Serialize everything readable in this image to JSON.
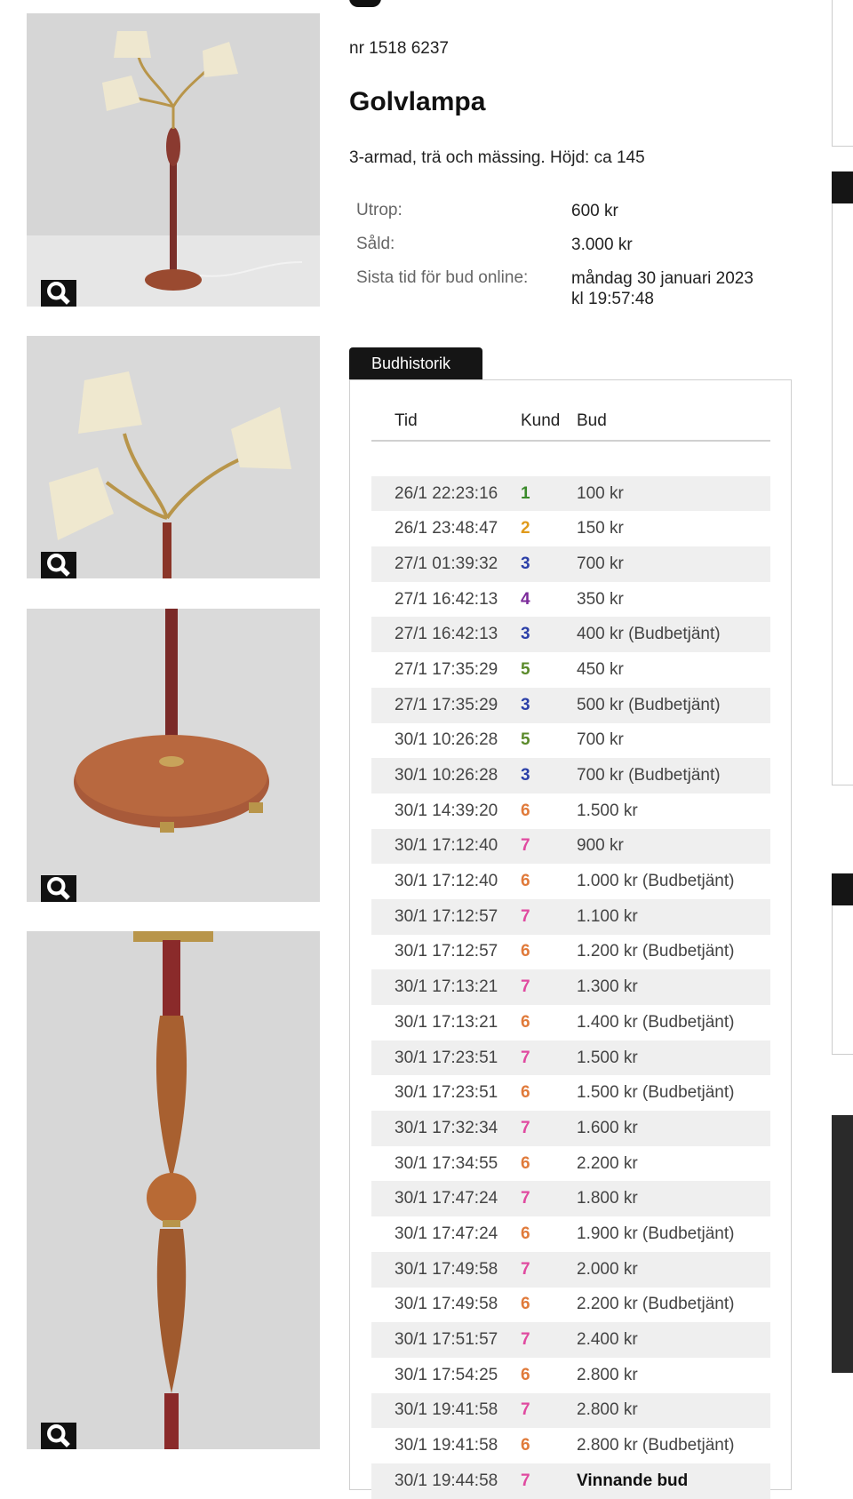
{
  "lot": {
    "number": "nr 1518 6237",
    "title": "Golvlampa",
    "description": "3-armad, trä och mässing. Höjd: ca 145"
  },
  "details": [
    {
      "label": "Utrop:",
      "value": "600 kr"
    },
    {
      "label": "Såld:",
      "value": "3.000 kr"
    },
    {
      "label": "Sista tid för bud online:",
      "value": "måndag 30 januari 2023",
      "value2": "kl 19:57:48"
    }
  ],
  "bid_history": {
    "tab_label": "Budhistorik",
    "columns": {
      "time": "Tid",
      "customer": "Kund",
      "bid": "Bud"
    },
    "customer_colors": {
      "1": "#3a8a2a",
      "2": "#e09a1a",
      "3": "#2b3fa8",
      "4": "#7b2a9a",
      "5": "#5a8a2a",
      "6": "#e07a3a",
      "7": "#e04aa0"
    },
    "rows": [
      {
        "time": "26/1 22:23:16",
        "customer": "1",
        "bid": "100 kr"
      },
      {
        "time": "26/1 23:48:47",
        "customer": "2",
        "bid": "150 kr"
      },
      {
        "time": "27/1 01:39:32",
        "customer": "3",
        "bid": "700 kr"
      },
      {
        "time": "27/1 16:42:13",
        "customer": "4",
        "bid": "350 kr"
      },
      {
        "time": "27/1 16:42:13",
        "customer": "3",
        "bid": "400 kr (Budbetjänt)"
      },
      {
        "time": "27/1 17:35:29",
        "customer": "5",
        "bid": "450 kr"
      },
      {
        "time": "27/1 17:35:29",
        "customer": "3",
        "bid": "500 kr (Budbetjänt)"
      },
      {
        "time": "30/1 10:26:28",
        "customer": "5",
        "bid": "700 kr"
      },
      {
        "time": "30/1 10:26:28",
        "customer": "3",
        "bid": "700 kr (Budbetjänt)"
      },
      {
        "time": "30/1 14:39:20",
        "customer": "6",
        "bid": "1.500 kr"
      },
      {
        "time": "30/1 17:12:40",
        "customer": "7",
        "bid": "900 kr"
      },
      {
        "time": "30/1 17:12:40",
        "customer": "6",
        "bid": "1.000 kr (Budbetjänt)"
      },
      {
        "time": "30/1 17:12:57",
        "customer": "7",
        "bid": "1.100 kr"
      },
      {
        "time": "30/1 17:12:57",
        "customer": "6",
        "bid": "1.200 kr (Budbetjänt)"
      },
      {
        "time": "30/1 17:13:21",
        "customer": "7",
        "bid": "1.300 kr"
      },
      {
        "time": "30/1 17:13:21",
        "customer": "6",
        "bid": "1.400 kr (Budbetjänt)"
      },
      {
        "time": "30/1 17:23:51",
        "customer": "7",
        "bid": "1.500 kr"
      },
      {
        "time": "30/1 17:23:51",
        "customer": "6",
        "bid": "1.500 kr (Budbetjänt)"
      },
      {
        "time": "30/1 17:32:34",
        "customer": "7",
        "bid": "1.600 kr"
      },
      {
        "time": "30/1 17:34:55",
        "customer": "6",
        "bid": "2.200 kr"
      },
      {
        "time": "30/1 17:47:24",
        "customer": "7",
        "bid": "1.800 kr"
      },
      {
        "time": "30/1 17:47:24",
        "customer": "6",
        "bid": "1.900 kr (Budbetjänt)"
      },
      {
        "time": "30/1 17:49:58",
        "customer": "7",
        "bid": "2.000 kr"
      },
      {
        "time": "30/1 17:49:58",
        "customer": "6",
        "bid": "2.200 kr (Budbetjänt)"
      },
      {
        "time": "30/1 17:51:57",
        "customer": "7",
        "bid": "2.400 kr"
      },
      {
        "time": "30/1 17:54:25",
        "customer": "6",
        "bid": "2.800 kr"
      },
      {
        "time": "30/1 19:41:58",
        "customer": "7",
        "bid": "2.800 kr"
      },
      {
        "time": "30/1 19:41:58",
        "customer": "6",
        "bid": "2.800 kr (Budbetjänt)"
      },
      {
        "time": "30/1 19:44:58",
        "customer": "7",
        "bid": "Vinnande bud",
        "winner": true
      }
    ]
  },
  "images": [
    {
      "icon": "lamp-full-photo"
    },
    {
      "icon": "lamp-shades-photo"
    },
    {
      "icon": "lamp-base-photo"
    },
    {
      "icon": "lamp-stem-photo"
    }
  ]
}
